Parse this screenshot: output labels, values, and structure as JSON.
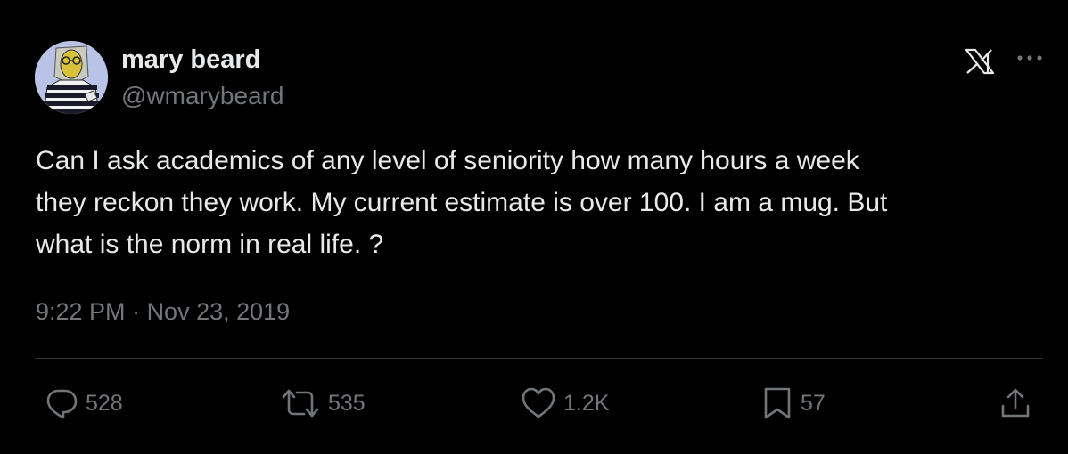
{
  "author": {
    "display_name": "mary beard",
    "handle": "@wmarybeard"
  },
  "tweet": {
    "text": "Can I ask academics of any level of seniority how many hours a week\nthey reckon they work. My current estimate is over 100. I am a mug. But\nwhat is the norm in real life. ?",
    "time": "9:22 PM",
    "separator": " · ",
    "date": "Nov 23, 2019"
  },
  "actions": {
    "replies": "528",
    "reposts": "535",
    "likes": "1.2K",
    "bookmarks": "57"
  },
  "colors": {
    "background": "#000000",
    "primary_text": "#e7e9ea",
    "secondary_text": "#71767b",
    "divider": "#2f3336"
  }
}
